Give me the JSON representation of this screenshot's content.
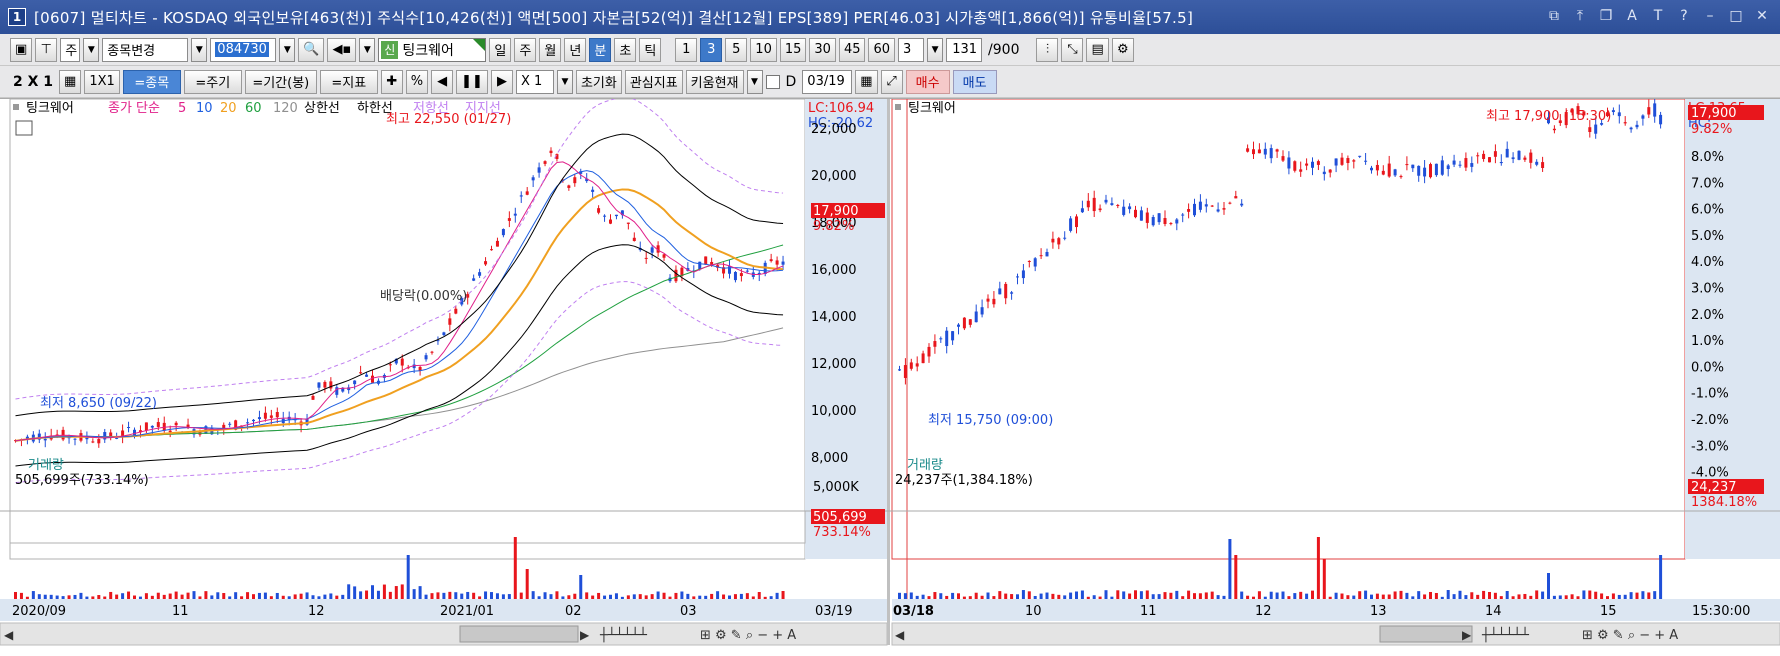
{
  "window": {
    "num_badge": "1",
    "title": "[0607] 멀티차트 - KOSDAQ 외국인보유[463(천)] 주식수[10,426(천)] 액면[500] 자본금[52(억)] 결산[12월] EPS[389] PER[46.03] 시가총액[1,866(억)] 유통비율[57.5]",
    "controls": [
      "⧉",
      "⤒",
      "❐",
      "A",
      "T",
      "?",
      "–",
      "□",
      "✕"
    ]
  },
  "toolbar1": {
    "mode_select": "주",
    "change_select": "종목변경",
    "code_value": "084730",
    "stock_badge": "신",
    "stock_name": "팅크웨어",
    "period_buttons": [
      "일",
      "주",
      "월",
      "년",
      "분",
      "초",
      "틱"
    ],
    "period_selected": "분",
    "interval_buttons": [
      "1",
      "3",
      "5",
      "10",
      "15",
      "30",
      "45",
      "60"
    ],
    "interval_selected": "3",
    "interval_input": "3",
    "count_input": "131",
    "count_total": "/900"
  },
  "toolbar2": {
    "layout_text": "2 X 1",
    "layout_1x1": "1X1",
    "buttons": [
      "=종목",
      "=주기",
      "=기간(봉)",
      "=지표"
    ],
    "pct_label": "%",
    "zoom_select": "X 1",
    "reset_label": "초기화",
    "interest_label": "관심지표",
    "kiwoom_label": "키움현재",
    "d_label": "D",
    "date_input": "03/19",
    "buy_label": "매수",
    "sell_label": "매도"
  },
  "left_chart": {
    "legend": {
      "name": "팅크웨어",
      "close_label": "종가 단순",
      "mas": [
        {
          "label": "5",
          "color": "#e0208a"
        },
        {
          "label": "10",
          "color": "#2060e0"
        },
        {
          "label": "20",
          "color": "#f0a020"
        },
        {
          "label": "60",
          "color": "#20a040"
        },
        {
          "label": "120",
          "color": "#909090"
        }
      ],
      "upper_band": "상한선",
      "lower_band": "하한선",
      "low_line": "저항선",
      "support_line": "지지선"
    },
    "lc": "LC:106.94",
    "hc": "HC:-20.62",
    "high_annotation": "최고 22,550 (01/27)",
    "low_annotation": "최저 8,650 (09/22)",
    "dividend_annotation": "배당락(0.00%)",
    "y_ticks": [
      "22,000",
      "20,000",
      "18,000",
      "16,000",
      "14,000",
      "12,000",
      "10,000",
      "8,000"
    ],
    "price_tag": "17,900",
    "pct_tag": "9.82%",
    "volume": {
      "title": "거래량",
      "value": "505,699주(733.14%)",
      "y_tick": "5,000K",
      "tag": "505,699",
      "tag_pct": "733.14%"
    },
    "x_labels": [
      "2020/09",
      "11",
      "12",
      "2021/01",
      "02",
      "03",
      "03/19"
    ]
  },
  "right_chart": {
    "legend": {
      "name": "팅크웨어"
    },
    "lc": "LC:13.65",
    "hc": "HC:",
    "high_annotation": "최고 17,900 (15:30)",
    "low_annotation": "최저 15,750 (09:00)",
    "y_ticks": [
      "9.82%",
      "8.0%",
      "7.0%",
      "6.0%",
      "5.0%",
      "4.0%",
      "3.0%",
      "2.0%",
      "1.0%",
      "0.0%",
      "-1.0%",
      "-2.0%",
      "-3.0%",
      "-4.0%"
    ],
    "price_tag": "17,900",
    "volume": {
      "title": "거래량",
      "value": "24,237주(1,384.18%)",
      "tag": "24,237",
      "tag_pct": "1384.18%"
    },
    "x_labels": [
      "03/18",
      "10",
      "11",
      "12",
      "13",
      "14",
      "15",
      "15:30:00"
    ]
  },
  "colors": {
    "up": "#e8161c",
    "down": "#1f4fd8",
    "axis_bg": "#dce6f2",
    "title_bg": "#2d4f98"
  }
}
